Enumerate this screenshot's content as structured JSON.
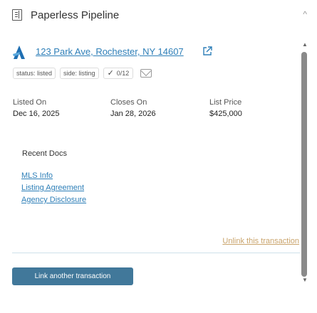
{
  "header": {
    "title": "Paperless Pipeline",
    "icon": "document-icon",
    "collapse_icon": "chevron-up-icon"
  },
  "property": {
    "address": "123 Park Ave, Rochester, NY 14607",
    "logo_icon": "paperless-pipeline-logo",
    "external_icon": "external-link-icon"
  },
  "tags": {
    "status": "status: listed",
    "side": "side: listing",
    "tasks": "0/12",
    "check_icon": "check-icon",
    "mail_icon": "mail-icon"
  },
  "details": [
    {
      "label": "Listed On",
      "value": "Dec 16, 2025"
    },
    {
      "label": "Closes On",
      "value": "Jan 28, 2026"
    },
    {
      "label": "List Price",
      "value": "$425,000"
    }
  ],
  "docs": {
    "heading": "Recent Docs",
    "items": [
      "MLS Info",
      "Listing Agreement",
      "Agency Disclosure"
    ]
  },
  "actions": {
    "unlink": "Unlink this transaction",
    "link_another": "Link another transaction"
  },
  "colors": {
    "link": "#2e7fb8",
    "unlink": "#c9a36a",
    "button": "#41789a",
    "logo": "#1f6fb2"
  }
}
